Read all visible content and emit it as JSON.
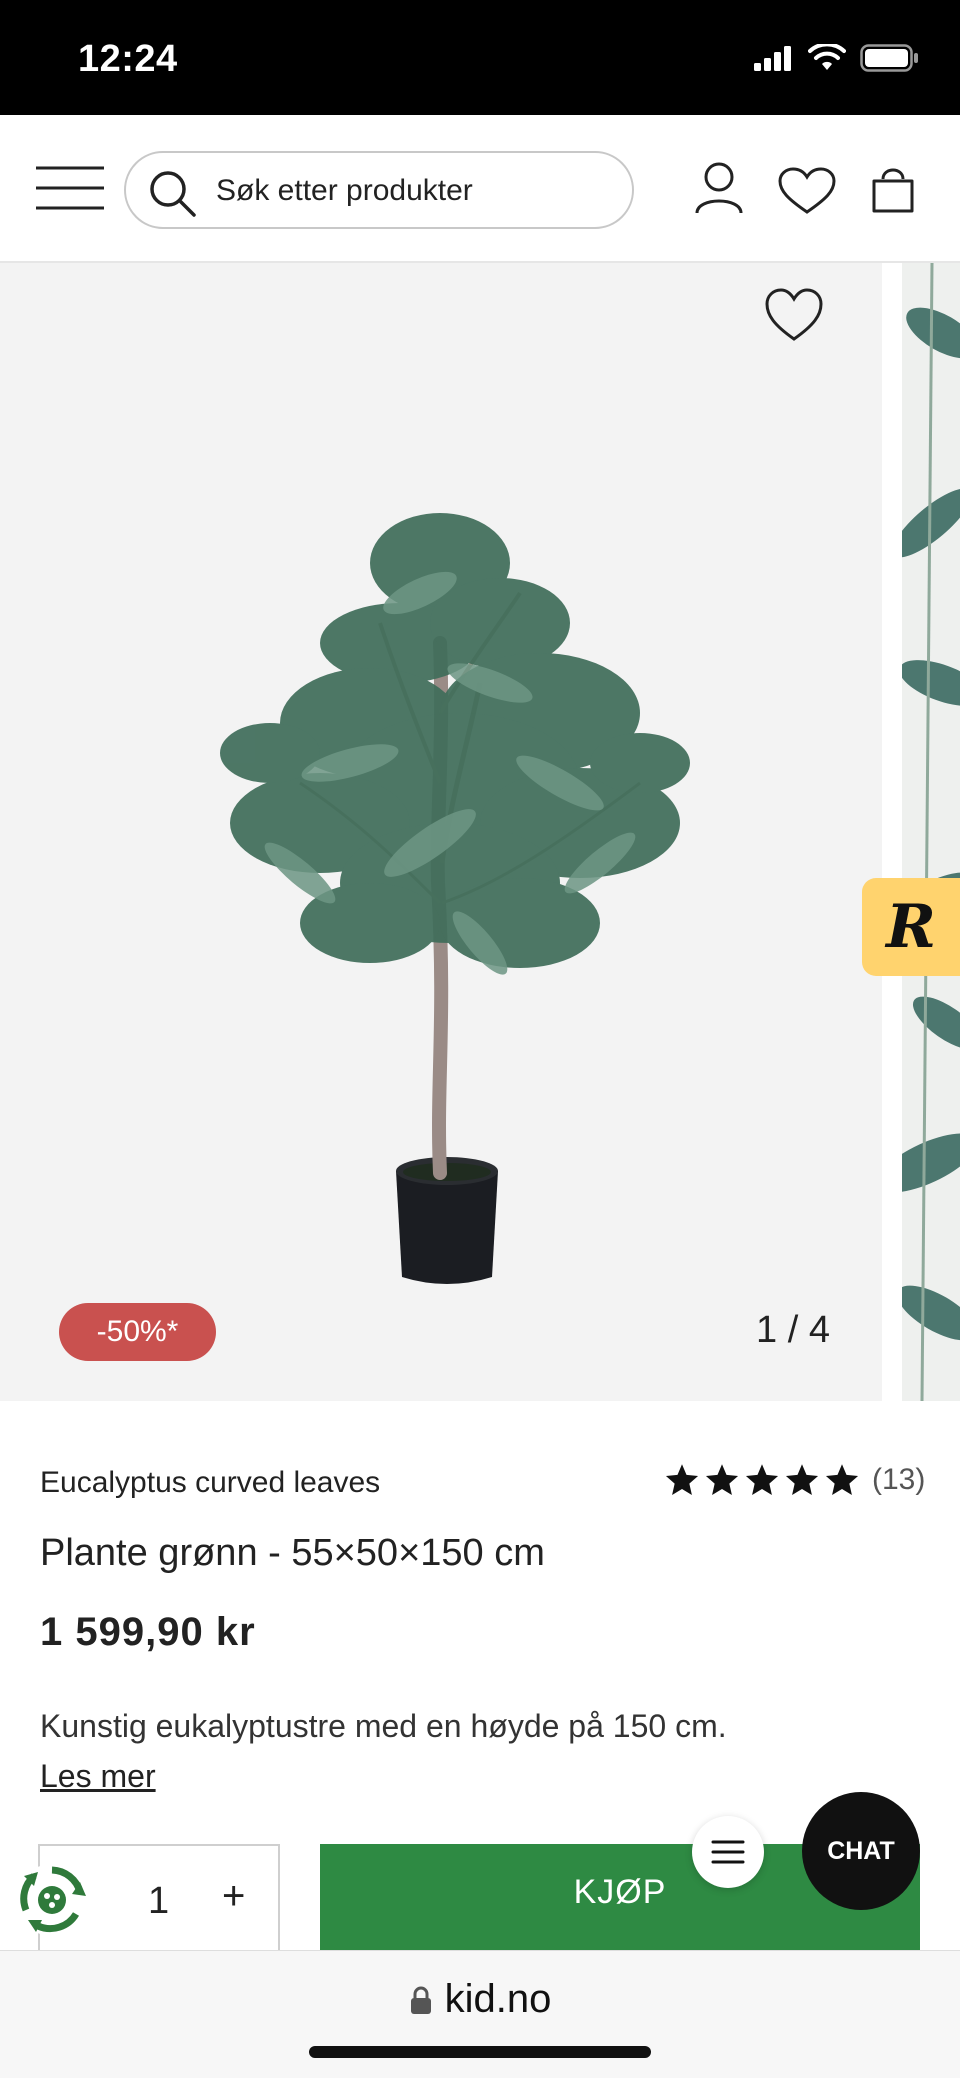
{
  "status_bar": {
    "time": "12:24"
  },
  "header": {
    "search_placeholder": "Søk etter produkter"
  },
  "gallery": {
    "discount_badge": "-50%*",
    "page_counter": "1 / 4",
    "side_badge_letter": "R"
  },
  "product": {
    "brand": "Eucalyptus curved leaves",
    "rating": {
      "stars": 5,
      "count": "(13)"
    },
    "title": "Plante grønn - 55×50×150 cm",
    "price": "1 599,90 kr",
    "description": "Kunstig eukalyptustre med en høyde på 150 cm.",
    "read_more": "Les mer"
  },
  "purchase": {
    "quantity": "1",
    "plus_symbol": "+",
    "buy_label": "KJØP"
  },
  "chat": {
    "label": "CHAT"
  },
  "browser": {
    "url": "kid.no"
  },
  "colors": {
    "buy_green": "#2e8a43",
    "discount_red": "#c9514f",
    "side_badge_yellow": "#ffd36e",
    "eco_green": "#2f7a3b"
  }
}
